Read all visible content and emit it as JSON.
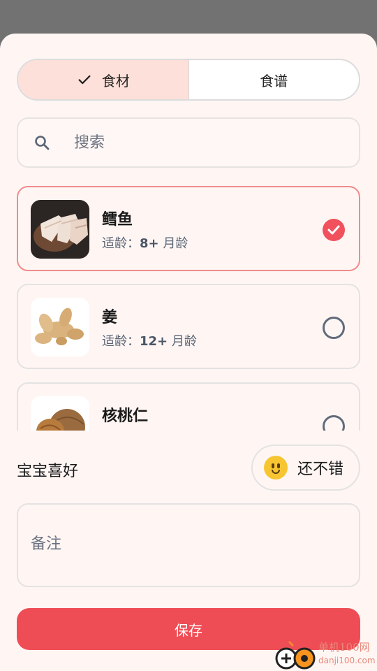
{
  "tabs": [
    {
      "label": "食材",
      "active": true
    },
    {
      "label": "食谱",
      "active": false
    }
  ],
  "search": {
    "placeholder": "搜索",
    "value": ""
  },
  "items": [
    {
      "name": "鳕鱼",
      "age_prefix": "适龄：",
      "age_value": "8+",
      "age_unit": "月龄",
      "selected": true,
      "image": "cod-fillet"
    },
    {
      "name": "姜",
      "age_prefix": "适龄：",
      "age_value": "12+",
      "age_unit": "月龄",
      "selected": false,
      "image": "ginger-root"
    },
    {
      "name": "核桃仁",
      "selected": false,
      "image": "walnuts"
    }
  ],
  "preference": {
    "label": "宝宝喜好",
    "choice": "还不错",
    "icon": "slightly-smiling-face"
  },
  "notes": {
    "placeholder": "备注",
    "value": ""
  },
  "save_label": "保存",
  "watermark": {
    "brand": "单机100网",
    "url": "danji100.com"
  },
  "colors": {
    "accent": "#ef4d56",
    "tab_active_bg": "#fde0d9",
    "sheet_bg": "#fff6f4",
    "backdrop": "#727272"
  }
}
